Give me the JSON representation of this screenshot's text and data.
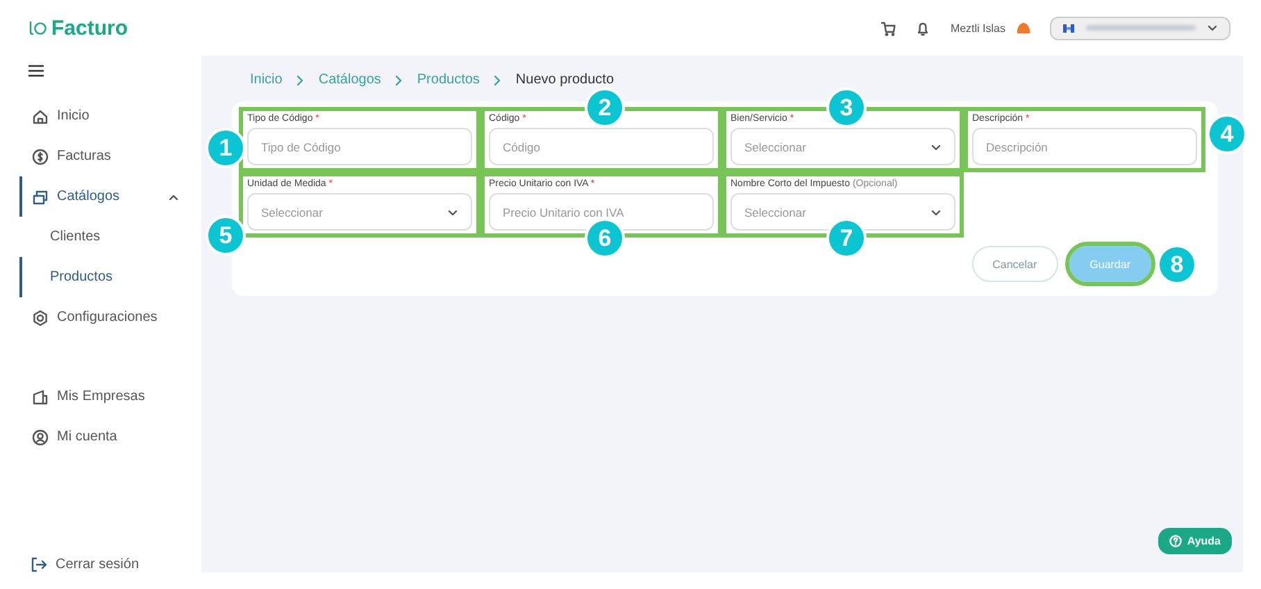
{
  "header": {
    "logo": "Facturo",
    "user": "Meztli Islas"
  },
  "sidebar": {
    "items": [
      {
        "label": "Inicio",
        "selected": false
      },
      {
        "label": "Facturas",
        "selected": false
      },
      {
        "label": "Catálogos",
        "selected": true,
        "expanded": true,
        "children": [
          {
            "label": "Clientes",
            "selected": false
          },
          {
            "label": "Productos",
            "selected": true
          }
        ]
      },
      {
        "label": "Configuraciones",
        "selected": false
      }
    ],
    "account_items": [
      {
        "label": "Mis Empresas",
        "selected": false
      },
      {
        "label": "Mi cuenta",
        "selected": false
      }
    ],
    "logout": "Cerrar sesión"
  },
  "breadcrumb": [
    {
      "label": "Inicio",
      "current": false
    },
    {
      "label": "Catálogos",
      "current": false
    },
    {
      "label": "Productos",
      "current": false
    },
    {
      "label": "Nuevo producto",
      "current": true
    }
  ],
  "form": {
    "fields": [
      {
        "label": "Tipo de Código",
        "required_mark": "*",
        "kind": "input",
        "placeholder": "Tipo de Código",
        "highlighted": true,
        "callout": "1"
      },
      {
        "label": "Código",
        "required_mark": "*",
        "kind": "input",
        "placeholder": "Código",
        "highlighted": true,
        "callout": "2"
      },
      {
        "label": "Bien/Servicio",
        "required_mark": "*",
        "kind": "select",
        "placeholder": "Seleccionar",
        "highlighted": true,
        "callout": "3"
      },
      {
        "label": "Descripción",
        "required_mark": "*",
        "kind": "input",
        "placeholder": "Descripción",
        "highlighted": true,
        "callout": "4"
      },
      {
        "label": "Unidad de Medida",
        "required_mark": "*",
        "kind": "select",
        "placeholder": "Seleccionar",
        "highlighted": true,
        "callout": "5"
      },
      {
        "label": "Precio Unitario con IVA",
        "required_mark": "*",
        "kind": "input",
        "placeholder": "Precio Unitario con IVA",
        "highlighted": true,
        "callout": "6"
      },
      {
        "label": "Nombre Corto del Impuesto",
        "note": "(Opcional)",
        "kind": "select",
        "placeholder": "Seleccionar",
        "highlighted": true,
        "callout": "7"
      }
    ],
    "buttons": [
      {
        "label": "Cancelar",
        "kind": "secondary",
        "highlighted": false
      },
      {
        "label": "Guardar",
        "kind": "primary",
        "disabled": true,
        "highlighted": true,
        "callout": "8"
      }
    ]
  },
  "help": "Ayuda"
}
